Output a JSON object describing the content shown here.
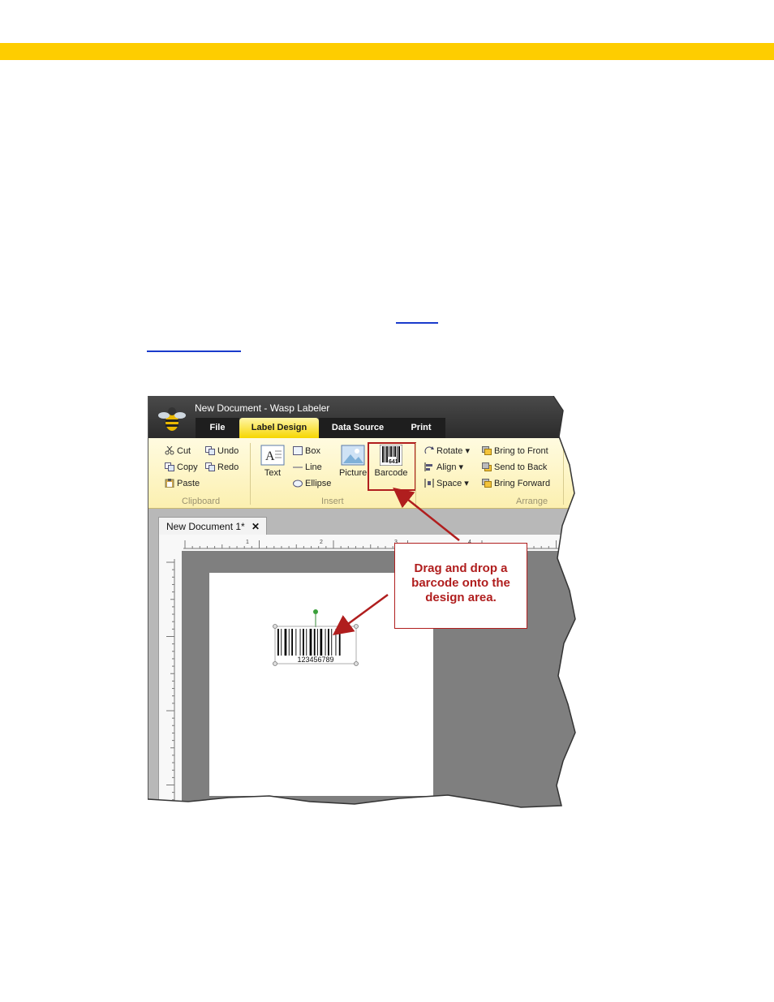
{
  "window": {
    "title": "New Document - Wasp Labeler"
  },
  "tabs": [
    {
      "label": "File"
    },
    {
      "label": "Label Design"
    },
    {
      "label": "Data Source"
    },
    {
      "label": "Print"
    }
  ],
  "ribbon": {
    "clipboard": {
      "cut": "Cut",
      "copy": "Copy",
      "paste": "Paste",
      "undo": "Undo",
      "redo": "Redo",
      "group": "Clipboard"
    },
    "insert": {
      "text": "Text",
      "box": "Box",
      "line": "Line",
      "ellipse": "Ellipse",
      "picture": "Picture",
      "barcode": "Barcode",
      "barcode_icon_text": "641",
      "group": "Insert"
    },
    "arrange": {
      "rotate": "Rotate",
      "align": "Align",
      "space": "Space",
      "bring_front": "Bring to Front",
      "send_back": "Send to Back",
      "bring_forward": "Bring Forward",
      "group": "Arrange"
    }
  },
  "document": {
    "tab_label": "New Document 1*",
    "ruler_marks": [
      "1",
      "2",
      "3",
      "4"
    ],
    "barcode_value": "123456789"
  },
  "callout": {
    "line1": "Drag and drop a",
    "line2": "barcode onto the",
    "line3": "design area."
  },
  "colors": {
    "accent_bar": "#fecd00",
    "callout_red": "#b01e1e",
    "ribbon_tab_active": "#f6d600"
  }
}
